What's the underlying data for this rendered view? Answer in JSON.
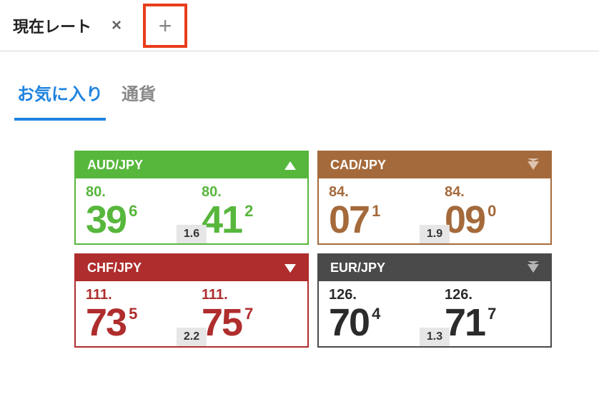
{
  "tab": {
    "title": "現在レート"
  },
  "filters": {
    "favorites": "お気に入り",
    "currency": "通貨"
  },
  "cards": [
    {
      "pair": "AUD/JPY",
      "dir": "up",
      "color": "green",
      "bid": {
        "handle": "80.",
        "big": "39",
        "pip": "6"
      },
      "ask": {
        "handle": "80.",
        "big": "41",
        "pip": "2"
      },
      "spread": "1.6"
    },
    {
      "pair": "CAD/JPY",
      "dir": "down-muted",
      "color": "brown",
      "bid": {
        "handle": "84.",
        "big": "07",
        "pip": "1"
      },
      "ask": {
        "handle": "84.",
        "big": "09",
        "pip": "0"
      },
      "spread": "1.9"
    },
    {
      "pair": "CHF/JPY",
      "dir": "down",
      "color": "red",
      "bid": {
        "handle": "111.",
        "big": "73",
        "pip": "5"
      },
      "ask": {
        "handle": "111.",
        "big": "75",
        "pip": "7"
      },
      "spread": "2.2"
    },
    {
      "pair": "EUR/JPY",
      "dir": "down-muted",
      "color": "dark",
      "bid": {
        "handle": "126.",
        "big": "70",
        "pip": "4"
      },
      "ask": {
        "handle": "126.",
        "big": "71",
        "pip": "7"
      },
      "spread": "1.3"
    }
  ]
}
